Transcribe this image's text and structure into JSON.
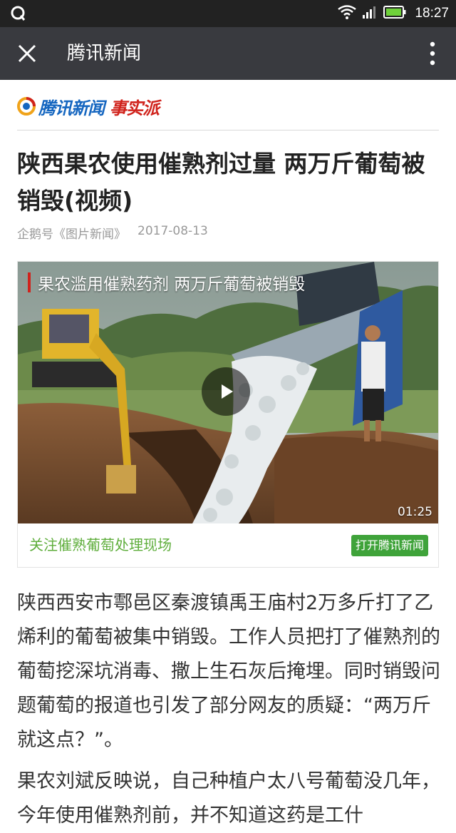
{
  "status_bar": {
    "time": "18:27",
    "left_icon": "q-app-icon",
    "icons": [
      "wifi-icon",
      "signal-icon",
      "battery-icon"
    ],
    "bg_color": "#222222"
  },
  "title_bar": {
    "title": "腾讯新闻",
    "bg_color": "#393a3f"
  },
  "brand": {
    "name": "腾讯新闻",
    "tag": "事实派",
    "blue": "#1566c0",
    "red": "#d0231c"
  },
  "article": {
    "headline": "陕西果农使用催熟剂过量 两万斤葡萄被销毁(视频)",
    "source": "企鹅号《图片新闻》",
    "date": "2017-08-13"
  },
  "video": {
    "caption": "果农滥用催熟药剂 两万斤葡萄被销毁",
    "duration": "01:25",
    "footer_link": "关注催熟葡萄处理现场",
    "open_button": "打开腾讯新闻",
    "accent": "#3fa33a"
  },
  "body": {
    "paragraph1": "陕西西安市鄠邑区秦渡镇禹王庙村2万多斤打了乙烯利的葡萄被集中销毁。工作人员把打了催熟剂的葡萄挖深坑消毒、撒上生石灰后掩埋。同时销毁问题葡萄的报道也引发了部分网友的质疑：“两万斤就这点？”。",
    "paragraph2": "果农刘斌反映说，自己种植户太八号葡萄没几年，今年使用催熟剂前，并不知道这药是工什"
  }
}
